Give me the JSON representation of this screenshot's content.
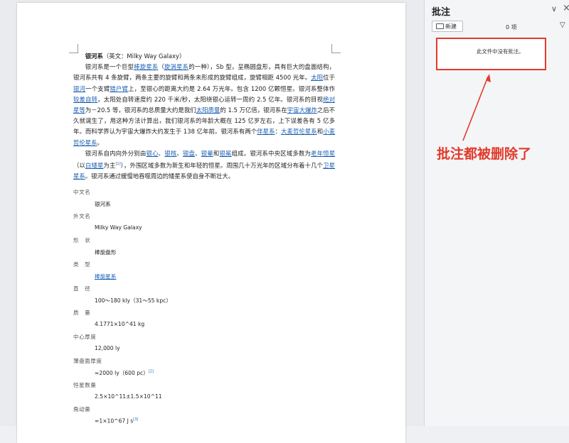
{
  "document": {
    "heading_term": "银河系",
    "heading_rest": "（英文：Milky Way Galaxy）",
    "para1": [
      {
        "t": "银河系是一个巨型"
      },
      {
        "t": "棒旋星系",
        "link": true
      },
      {
        "t": "（"
      },
      {
        "t": "旋涡星系",
        "link": true
      },
      {
        "t": "的一种），Sb 型，呈椭圆盘形，具有巨大的盘面结构，银河系共有 4 条旋臂，两条主要的旋臂和两条未形成的旋臂组成，旋臂相距 4500 光年。"
      },
      {
        "t": "太阳",
        "link": true
      },
      {
        "t": "位于"
      },
      {
        "t": "银河",
        "link": true
      },
      {
        "t": "一个支臂"
      },
      {
        "t": "猎户臂",
        "link": true
      },
      {
        "t": "上，至银心的距离大约是 2.64 万光年。包含 1200 亿颗恒星。银河系整体作"
      },
      {
        "t": "较差自转",
        "link": true
      },
      {
        "t": "，太阳处自转速度约 220 千米/秒，太阳绕银心运转一周约 2.5 亿年。银河系的目视"
      },
      {
        "t": "绝对星等",
        "link": true
      },
      {
        "t": "为－20.5 等，银河系的总质量大约是我们"
      },
      {
        "t": "太阳质量",
        "link": true
      },
      {
        "t": "的 1.5 万亿倍，银河系在"
      },
      {
        "t": "宇宙大爆炸",
        "link": true
      },
      {
        "t": "之后不久就诞生了，用这种方法计算出，我们银河系的年龄大概在 125 亿岁左右，上下误差各有 5 亿多年。而科学界认为宇宙大爆炸大约发生于 138 亿年前。银河系有两个"
      },
      {
        "t": "伴星系",
        "link": true
      },
      {
        "t": "："
      },
      {
        "t": "大麦哲伦星系",
        "link": true
      },
      {
        "t": "和"
      },
      {
        "t": "小麦哲伦星系",
        "link": true
      },
      {
        "t": "。"
      }
    ],
    "para2": [
      {
        "t": "银河系自内向外分别由"
      },
      {
        "t": "银心",
        "link": true
      },
      {
        "t": "、"
      },
      {
        "t": "银核",
        "link": true
      },
      {
        "t": "、"
      },
      {
        "t": "银盘",
        "link": true
      },
      {
        "t": "、"
      },
      {
        "t": "银晕",
        "link": true
      },
      {
        "t": "和"
      },
      {
        "t": "银冕",
        "link": true
      },
      {
        "t": "组成。银河系中央区域多数为"
      },
      {
        "t": "老年恒星",
        "link": true
      },
      {
        "t": "（以"
      },
      {
        "t": "白矮星",
        "link": true
      },
      {
        "t": "为主"
      },
      {
        "t": "[1]",
        "sup": true
      },
      {
        "t": "），外围区域多数为新生和年轻的恒星。周围几十万光年的区域分布着十几个"
      },
      {
        "t": "卫星星系",
        "link": true
      },
      {
        "t": "。银河系通过缓慢地吞噬周边的矮星系使自身不断壮大。"
      }
    ],
    "info": [
      {
        "label": "中文名",
        "value": "银河系"
      },
      {
        "label": "外文名",
        "value": "Milky Way Galaxy"
      },
      {
        "label": "形　状",
        "value": "棒旋盘形"
      },
      {
        "label": "类　型",
        "value": "棒旋星系",
        "link": true
      },
      {
        "label": "直　径",
        "value": "100～180 kly（31～55 kpc）"
      },
      {
        "label": "质　量",
        "value": "4.1771×10^41 kg"
      },
      {
        "label": "中心厚度",
        "value": "12,000 ly"
      },
      {
        "label": "薄盘面厚度",
        "value": "≈2000 ly（600 pc）",
        "sup": "[2]"
      },
      {
        "label": "恒星数量",
        "value": "2.5×10^11±1.5×10^11"
      },
      {
        "label": "角动量",
        "value": "≈1×10^67 J s",
        "sup": "[3]"
      }
    ]
  },
  "panel": {
    "title": "批注",
    "new_button": "新建",
    "count": "0 项",
    "empty_message": "此文件中没有批注。"
  },
  "annotation": {
    "text": "批注都被删除了",
    "color": "#e23a2b"
  }
}
